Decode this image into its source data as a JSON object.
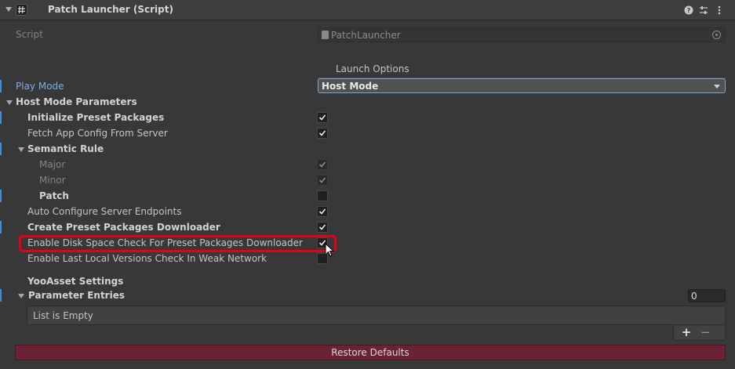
{
  "header": {
    "title": "Patch Launcher (Script)",
    "icons": [
      "help-icon",
      "presets-icon",
      "menu-icon"
    ]
  },
  "script": {
    "label": "Script",
    "value": "PatchLauncher"
  },
  "section": {
    "title": "Launch Options"
  },
  "play_mode": {
    "label": "Play Mode",
    "value": "Host Mode"
  },
  "host_params": {
    "label": "Host Mode Parameters",
    "initialize_preset": {
      "label": "Initialize Preset Packages",
      "checked": true
    },
    "fetch_app_config": {
      "label": "Fetch App Config From Server",
      "checked": true
    },
    "semantic_rule": {
      "label": "Semantic Rule",
      "major": {
        "label": "Major",
        "checked": true
      },
      "minor": {
        "label": "Minor",
        "checked": true
      },
      "patch": {
        "label": "Patch",
        "checked": false
      }
    },
    "auto_configure": {
      "label": "Auto Configure Server Endpoints",
      "checked": true
    },
    "create_downloader": {
      "label": "Create Preset Packages Downloader",
      "checked": true
    },
    "disk_space_check": {
      "label": "Enable Disk Space Check For Preset Packages Downloader",
      "checked": true
    },
    "last_local_versions": {
      "label": "Enable Last Local Versions Check In Weak Network",
      "checked": false
    }
  },
  "yooasset": {
    "label": "YooAsset Settings",
    "parameter_entries": {
      "label": "Parameter Entries",
      "count": "0",
      "empty_text": "List is Empty"
    },
    "add_symbol": "+",
    "remove_symbol": "−"
  },
  "restore_defaults": {
    "label": "Restore Defaults"
  },
  "colors": {
    "accent": "#7bafe7",
    "highlight": "#e4001b",
    "restore": "#6b2234"
  }
}
